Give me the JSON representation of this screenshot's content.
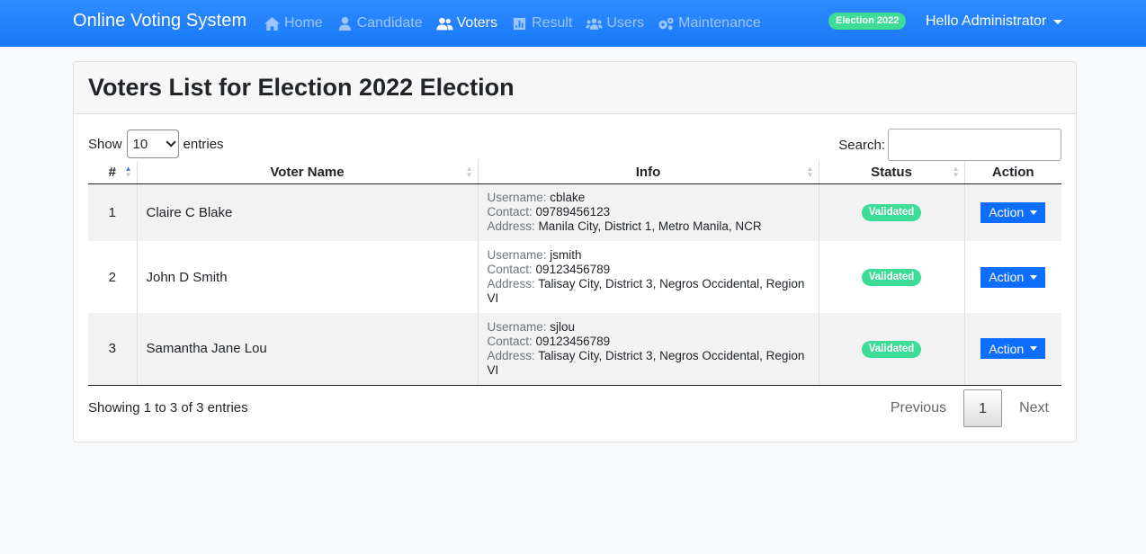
{
  "app": {
    "brand": "Online Voting System",
    "election_badge": "Election 2022",
    "user_greeting": "Hello Administrator"
  },
  "nav": [
    {
      "label": "Home",
      "icon": "home-icon",
      "active": false
    },
    {
      "label": "Candidate",
      "icon": "user-tie-icon",
      "active": false
    },
    {
      "label": "Voters",
      "icon": "users-icon",
      "active": true
    },
    {
      "label": "Result",
      "icon": "poll-icon",
      "active": false
    },
    {
      "label": "Users",
      "icon": "users-cog-icon",
      "active": false
    },
    {
      "label": "Maintenance",
      "icon": "cogs-icon",
      "active": false
    }
  ],
  "page": {
    "title": "Voters List for Election 2022 Election"
  },
  "controls": {
    "show_label": "Show",
    "entries_value": "10",
    "entries_label": "entries",
    "search_label": "Search:",
    "search_value": ""
  },
  "table": {
    "headers": [
      "#",
      "Voter Name",
      "Info",
      "Status",
      "Action"
    ],
    "rows": [
      {
        "num": "1",
        "name": "Claire C Blake",
        "username_label": "Username:",
        "username": "cblake",
        "contact_label": "Contact:",
        "contact": "09789456123",
        "address_label": "Address:",
        "address": "Manila City, District 1, Metro Manila, NCR",
        "status": "Validated",
        "action": "Action"
      },
      {
        "num": "2",
        "name": "John D Smith",
        "username_label": "Username:",
        "username": "jsmith",
        "contact_label": "Contact:",
        "contact": "09123456789",
        "address_label": "Address:",
        "address": "Talisay City, District 3, Negros Occidental, Region VI",
        "status": "Validated",
        "action": "Action"
      },
      {
        "num": "3",
        "name": "Samantha Jane Lou",
        "username_label": "Username:",
        "username": "sjlou",
        "contact_label": "Contact:",
        "contact": "09123456789",
        "address_label": "Address:",
        "address": "Talisay City, District 3, Negros Occidental, Region VI",
        "status": "Validated",
        "action": "Action"
      }
    ]
  },
  "footer": {
    "info": "Showing 1 to 3 of 3 entries",
    "previous": "Previous",
    "current_page": "1",
    "next": "Next"
  }
}
